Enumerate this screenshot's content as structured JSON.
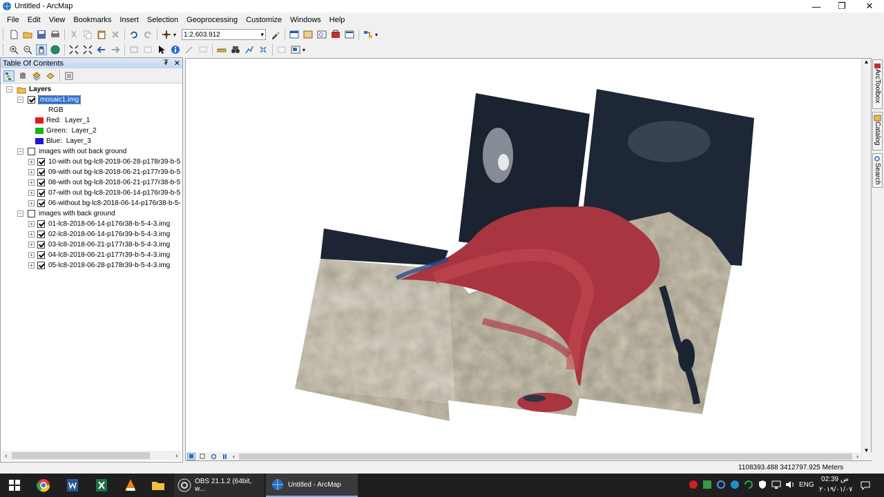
{
  "window": {
    "title": "Untitled - ArcMap",
    "minimize": "—",
    "maximize": "❐",
    "close": "✕"
  },
  "menu": [
    "File",
    "Edit",
    "View",
    "Bookmarks",
    "Insert",
    "Selection",
    "Geoprocessing",
    "Customize",
    "Windows",
    "Help"
  ],
  "toolbar": {
    "scale_value": "1:2.603.912",
    "scale_arrow": "▾",
    "grip_arrow": "▾"
  },
  "toc": {
    "title": "Table Of Contents",
    "pin": "₮",
    "close": "✕",
    "layers_label": "Layers",
    "mosaic_label": "mosaic1.img",
    "rgb_label": "RGB",
    "bands": [
      {
        "channel": "Red:",
        "layer": "Layer_1",
        "color": "#e21c1c"
      },
      {
        "channel": "Green:",
        "layer": "Layer_2",
        "color": "#16b416"
      },
      {
        "channel": "Blue:",
        "layer": "Layer_3",
        "color": "#1818d8"
      }
    ],
    "group1_label": "images with out back ground",
    "group1_items": [
      "10-with out bg-lc8-2018-06-28-p178r39-b-5",
      "09-with out bg-lc8-2018-06-21-p177r39-b-5",
      "08-with out bg-lc8-2018-06-21-p177r38-b-5",
      "07-with out bg-lc8-2018-06-14-p176r39-b-5",
      "06-without bg-lc8-2018-06-14-p176r38-b-5-"
    ],
    "group2_label": "images with back ground",
    "group2_items": [
      "01-lc8-2018-06-14-p176r38-b-5-4-3.img",
      "02-lc8-2018-06-14-p176r39-b-5-4-3.img",
      "03-lc8-2018-06-21-p177r38-b-5-4-3.img",
      "04-lc8-2018-06-21-p177r39-b-5-4-3.img",
      "05-lc8-2018-06-28-p178r39-b-5-4-3.img"
    ]
  },
  "sidetabs": [
    "ArcToolbox",
    "Catalog",
    "Search"
  ],
  "status": {
    "coords": "1108393.488  3412797.925 Meters"
  },
  "taskbar": {
    "obs_label": "OBS 21.1.2 (64bit, w...",
    "arcmap_label": "Untitled - ArcMap",
    "lang": "ENG",
    "time": "02:39 ص",
    "date": "٢٠١٩/٠١/٠٧"
  },
  "colors": {
    "accent": "#3070d0",
    "taskbar": "#1f1f1f",
    "toc_header": "#c3d6ef"
  }
}
